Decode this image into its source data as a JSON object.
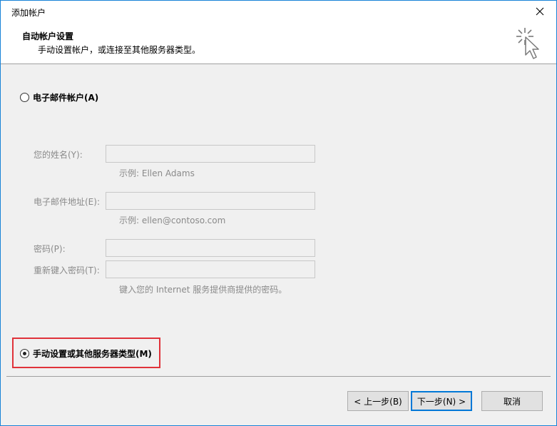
{
  "window": {
    "title": "添加帐户"
  },
  "header": {
    "title": "自动帐户设置",
    "subtitle": "手动设置帐户，或连接至其他服务器类型。",
    "icon": "wizard-cursor-icon"
  },
  "options": {
    "email_account": {
      "label": "电子邮件帐户(A)",
      "checked": false
    },
    "manual_setup": {
      "label": "手动设置或其他服务器类型(M)",
      "checked": true
    }
  },
  "fields": {
    "name": {
      "label": "您的姓名(Y):",
      "value": "",
      "hint": "示例: Ellen Adams"
    },
    "email": {
      "label": "电子邮件地址(E):",
      "value": "",
      "hint": "示例: ellen@contoso.com"
    },
    "password": {
      "label": "密码(P):",
      "value": ""
    },
    "password_confirm": {
      "label": "重新键入密码(T):",
      "value": "",
      "hint": "键入您的 Internet 服务提供商提供的密码。"
    }
  },
  "buttons": {
    "back": "< 上一步(B)",
    "next": "下一步(N) >",
    "cancel": "取消"
  },
  "colors": {
    "accent": "#0078d7",
    "highlight": "#e0323a",
    "window_border": "#1883d7"
  }
}
